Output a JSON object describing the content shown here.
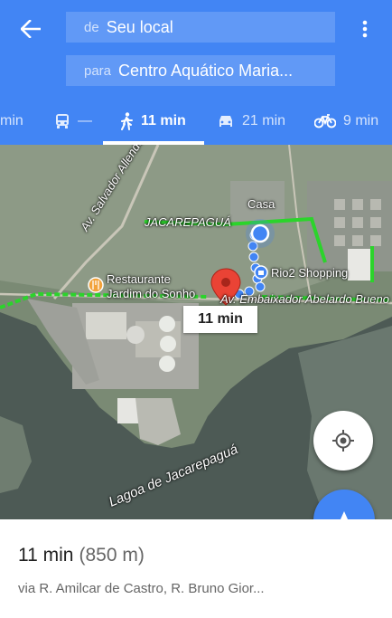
{
  "header": {
    "from": {
      "prefix": "de",
      "value": "Seu local"
    },
    "to": {
      "prefix": "para",
      "value": "Centro Aquático Maria..."
    },
    "modes": [
      {
        "label": "min",
        "icon": "car-icon"
      },
      {
        "label": "—",
        "icon": "transit-icon"
      },
      {
        "label": "11 min",
        "icon": "walk-icon",
        "selected": true
      },
      {
        "label": "21 min",
        "icon": "car-icon"
      },
      {
        "label": "9 min",
        "icon": "bike-icon"
      }
    ]
  },
  "map": {
    "labels": {
      "home": "Casa",
      "neighborhood": "JACAREPAGUÁ",
      "avenue_allende": "Av. Salvador Allende",
      "restaurant": "Restaurante\nJardim do Sonho",
      "mall": "Rio2 Shopping",
      "avenue_bueno": "Av. Embaixador Abelardo Bueno",
      "lagoon": "Lagoa de Jacarepaguá"
    },
    "route_time": "11 min"
  },
  "summary": {
    "time": "11 min",
    "distance": "(850 m)",
    "via": "via R. Amilcar de Castro, R. Bruno Gior..."
  },
  "colors": {
    "brand": "#4285f4",
    "route": "#4285f4",
    "traffic": "#2bd42b",
    "pin": "#ea4335"
  }
}
